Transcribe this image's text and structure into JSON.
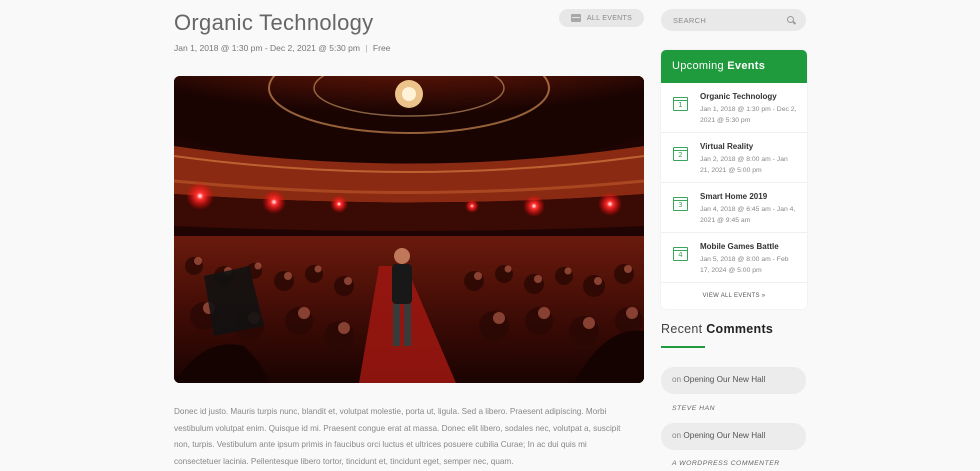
{
  "event": {
    "title": "Organic Technology",
    "dates": "Jan 1, 2018 @ 1:30 pm - Dec 2, 2021 @ 5:30 pm",
    "separator": "|",
    "price": "Free",
    "all_events_label": "ALL EVENTS",
    "body": "Donec id justo. Mauris turpis nunc, blandit et, volutpat molestie, porta ut, ligula. Sed a libero. Praesent adipiscing. Morbi vestibulum volutpat enim. Quisque id mi. Praesent congue erat at massa. Donec elit libero, sodales nec, volutpat a, suscipit non, turpis. Vestibulum ante ipsum primis in faucibus orci luctus et ultrices posuere cubilia Curae; In ac dui quis mi consectetuer lacinia. Pellentesque libero tortor, tincidunt et, tincidunt eget, semper nec, quam."
  },
  "search": {
    "placeholder": "SEARCH"
  },
  "upcoming": {
    "title_light": "Upcoming",
    "title_bold": "Events",
    "items": [
      {
        "name": "Organic Technology",
        "dates": "Jan 1, 2018 @ 1:30 pm - Dec 2, 2021 @ 5:30 pm",
        "day": "1"
      },
      {
        "name": "Virtual Reality",
        "dates": "Jan 2, 2018 @ 8:00 am - Jan 21, 2021 @ 5:00 pm",
        "day": "2"
      },
      {
        "name": "Smart Home 2019",
        "dates": "Jan 4, 2018 @ 6:45 am - Jan 4, 2021 @ 9:45 am",
        "day": "3"
      },
      {
        "name": "Mobile Games Battle",
        "dates": "Jan 5, 2018 @ 8:00 am - Feb 17, 2024 @ 5:00 pm",
        "day": "4"
      }
    ],
    "view_all_label": "VIEW ALL EVENTS »"
  },
  "recent_comments": {
    "title_light": "Recent",
    "title_bold": "Comments",
    "items": [
      {
        "on": "on",
        "post": "Opening Our New Hall",
        "author": "STEVE HAN"
      },
      {
        "on": "on",
        "post": "Opening Our New Hall",
        "author": "A WORDPRESS COMMENTER"
      }
    ]
  },
  "colors": {
    "accent": "#1f9a3c",
    "background": "#f9f9f9"
  }
}
